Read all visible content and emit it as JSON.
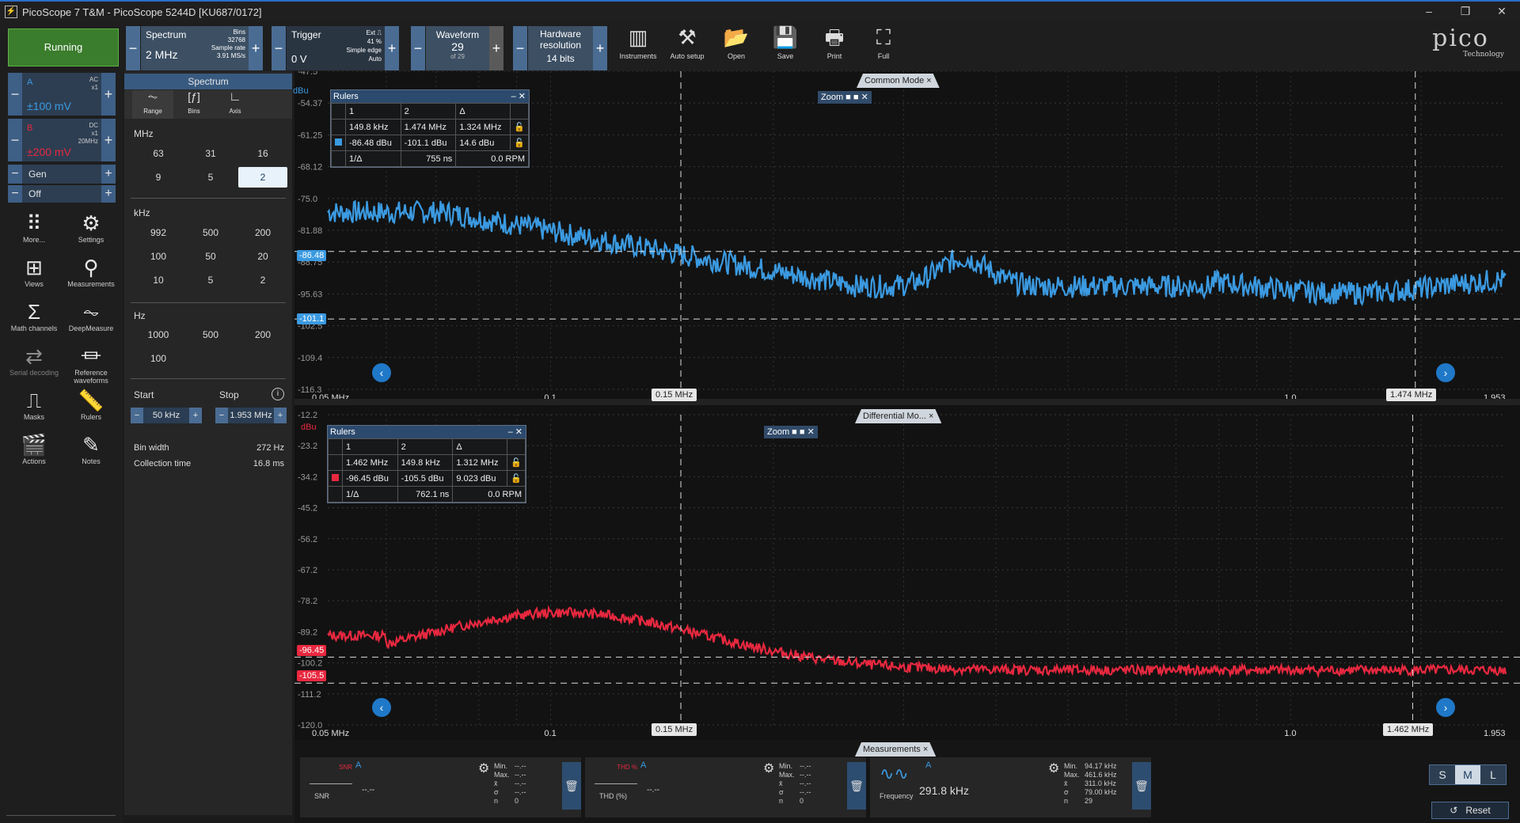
{
  "window": {
    "title": "PicoScope 7 T&M - PicoScope 5244D [KU687/0172]"
  },
  "toolbar": {
    "run_label": "Running",
    "spectrum": {
      "label": "Spectrum",
      "value": "2 MHz",
      "bins_label": "Bins",
      "bins": "32768",
      "sample_rate_label": "Sample rate",
      "sample_rate": "3.91 MS/s"
    },
    "trigger": {
      "label": "Trigger",
      "value": "0 V",
      "source": "Ext",
      "pct": "41 %",
      "type": "Simple edge",
      "mode": "Auto"
    },
    "waveform": {
      "label": "Waveform",
      "value": "29",
      "of": "of 29"
    },
    "hw_res": {
      "label1": "Hardware",
      "label2": "resolution",
      "value": "14 bits"
    },
    "tools": [
      {
        "name": "instruments",
        "label": "Instruments",
        "icon": "▥"
      },
      {
        "name": "auto-setup",
        "label": "Auto setup",
        "icon": "⚒"
      },
      {
        "name": "open",
        "label": "Open",
        "icon": "📂"
      },
      {
        "name": "save",
        "label": "Save",
        "icon": "💾"
      },
      {
        "name": "print",
        "label": "Print",
        "icon": "🖶"
      },
      {
        "name": "full",
        "label": "Full",
        "icon": "⛶"
      }
    ],
    "logo": "pico",
    "logo_sub": "Technology"
  },
  "channels": {
    "a": {
      "name": "A",
      "coupling": "AC",
      "probe": "x1",
      "range": "±100 mV",
      "color": "#3b9ae1"
    },
    "b": {
      "name": "B",
      "coupling": "DC",
      "probe": "x1",
      "bw": "20MHz",
      "range": "±200 mV",
      "color": "#e8283f"
    },
    "gen": "Gen",
    "off": "Off"
  },
  "nav": [
    {
      "name": "more",
      "label": "More...",
      "icon": "⠿"
    },
    {
      "name": "settings",
      "label": "Settings",
      "icon": "⚙"
    },
    {
      "name": "views",
      "label": "Views",
      "icon": "⊞"
    },
    {
      "name": "measurements",
      "label": "Measurements",
      "icon": "⚲"
    },
    {
      "name": "math-channels",
      "label": "Math channels",
      "icon": "Σ"
    },
    {
      "name": "deepmeasure",
      "label": "DeepMeasure",
      "icon": "⏦"
    },
    {
      "name": "serial-decoding",
      "label": "Serial decoding",
      "icon": "⇄"
    },
    {
      "name": "reference-waveforms",
      "label": "Reference waveforms",
      "icon": "⏛"
    },
    {
      "name": "masks",
      "label": "Masks",
      "icon": "⎍"
    },
    {
      "name": "rulers",
      "label": "Rulers",
      "icon": "📏"
    },
    {
      "name": "actions",
      "label": "Actions",
      "icon": "🎬"
    },
    {
      "name": "notes",
      "label": "Notes",
      "icon": "✎"
    }
  ],
  "panel": {
    "title": "Spectrum",
    "tabs": [
      "Range",
      "Bins",
      "Axis"
    ],
    "mhz_label": "MHz",
    "mhz": [
      "63",
      "31",
      "16",
      "9",
      "5",
      "2"
    ],
    "khz_label": "kHz",
    "khz": [
      "992",
      "500",
      "200",
      "100",
      "50",
      "20",
      "10",
      "5",
      "2"
    ],
    "hz_label": "Hz",
    "hz": [
      "1000",
      "500",
      "200",
      "100"
    ],
    "start_label": "Start",
    "stop_label": "Stop",
    "start": "50 kHz",
    "stop": "1.953 MHz",
    "bin_width_label": "Bin width",
    "bin_width": "272 Hz",
    "collection_label": "Collection time",
    "collection": "16.8 ms"
  },
  "top_plot": {
    "tab": "Common Mode",
    "unit": "dBu",
    "yticks": [
      "-47.5",
      "-54.37",
      "-61.25",
      "-68.12",
      "-75.0",
      "-81.88",
      "-88.75",
      "-95.63",
      "-102.5",
      "-109.4",
      "-116.3"
    ],
    "xticks": [
      "0.05 MHz",
      "0.1",
      "1.0",
      "1.953"
    ],
    "ruler_x1": "0.15 MHz",
    "ruler_x2": "1.474 MHz",
    "level1": "-86.48",
    "level2": "-101.1",
    "rulers": {
      "title": "Rulers",
      "h1": "1",
      "h2": "2",
      "hd": "Δ",
      "r1": [
        "149.8 kHz",
        "1.474 MHz",
        "1.324 MHz"
      ],
      "r2": [
        "-86.48 dBu",
        "-101.1 dBu",
        "14.6 dBu"
      ],
      "inv_label": "1/Δ",
      "inv": "755 ns",
      "rpm": "0.0 RPM"
    },
    "zoom": "Zoom"
  },
  "bottom_plot": {
    "tab": "Differential Mo...",
    "unit": "dBu",
    "yticks": [
      "-12.2",
      "-23.2",
      "-34.2",
      "-45.2",
      "-56.2",
      "-67.2",
      "-78.2",
      "-89.2",
      "-100.2",
      "-111.2",
      "-120.0"
    ],
    "xticks": [
      "0.05 MHz",
      "0.1",
      "1.0",
      "1.953"
    ],
    "ruler_x1": "0.15 MHz",
    "ruler_x2": "1.462 MHz",
    "level1": "-96.45",
    "level2": "-105.5",
    "rulers": {
      "title": "Rulers",
      "h1": "1",
      "h2": "2",
      "hd": "Δ",
      "r1": [
        "1.462 MHz",
        "149.8 kHz",
        "1.312 MHz"
      ],
      "r2": [
        "-96.45 dBu",
        "-105.5 dBu",
        "9.023 dBu"
      ],
      "inv_label": "1/Δ",
      "inv": "762.1 ns",
      "rpm": "0.0 RPM"
    },
    "zoom": "Zoom"
  },
  "measurements": {
    "tab": "Measurements",
    "stat_labels": [
      "Min.",
      "Max.",
      "x̄",
      "σ",
      "n"
    ],
    "cards": [
      {
        "name": "snr",
        "icon_text": "SNR",
        "channel": "A",
        "label": "SNR",
        "value": "--.--",
        "stats": [
          "--.--",
          "--.--",
          "--.--",
          "--.--",
          "0"
        ]
      },
      {
        "name": "thd",
        "icon_text": "THD %",
        "channel": "A",
        "label": "THD (%)",
        "value": "--.--",
        "stats": [
          "--.--",
          "--.--",
          "--.--",
          "--.--",
          "0"
        ]
      },
      {
        "name": "frequency",
        "icon_text": "",
        "channel": "A",
        "label": "Frequency",
        "value": "291.8 kHz",
        "stats": [
          "94.17 kHz",
          "461.6 kHz",
          "311.0 kHz",
          "79.00 kHz",
          "29"
        ]
      }
    ],
    "sizes": [
      "S",
      "M",
      "L"
    ],
    "reset": "Reset"
  }
}
